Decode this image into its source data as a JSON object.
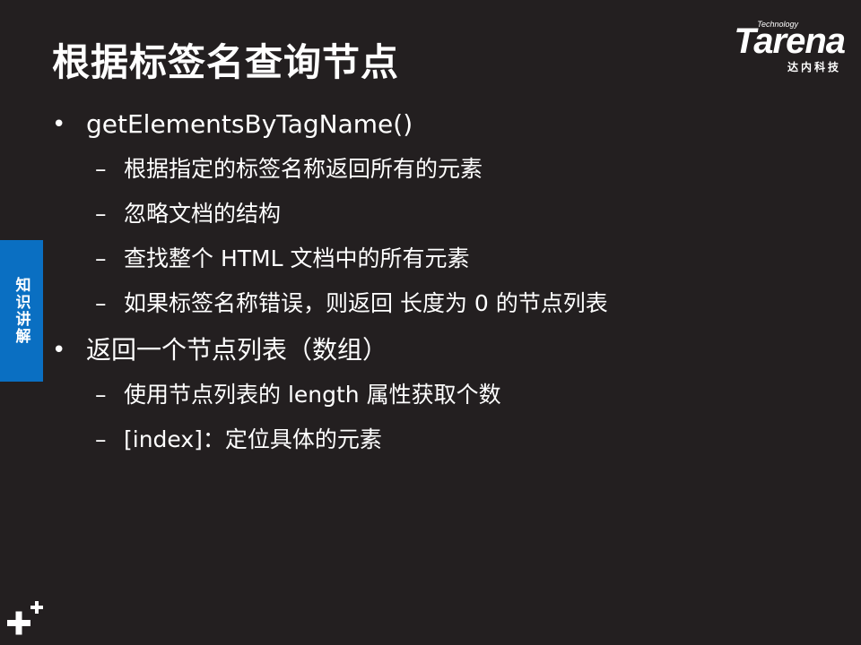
{
  "slide": {
    "title": "根据标签名查询节点"
  },
  "logo": {
    "tech": "Technology",
    "brand": "Tarena",
    "subtitle": "达内科技"
  },
  "side_tab": {
    "label": "知识讲解",
    "color": "#0a6fc2"
  },
  "bullets": [
    {
      "text": "getElementsByTagName()",
      "subitems": [
        "根据指定的标签名称返回所有的元素",
        "忽略文档的结构",
        "查找整个 HTML 文档中的所有元素",
        "如果标签名称错误，则返回 长度为 0 的节点列表"
      ]
    },
    {
      "text": "返回一个节点列表（数组）",
      "subitems": [
        "使用节点列表的 length 属性获取个数",
        "[index]：定位具体的元素"
      ]
    }
  ],
  "bullet_glyph": "•",
  "dash_glyph": "–",
  "colors": {
    "background": "#231f20",
    "text": "#ffffff"
  }
}
